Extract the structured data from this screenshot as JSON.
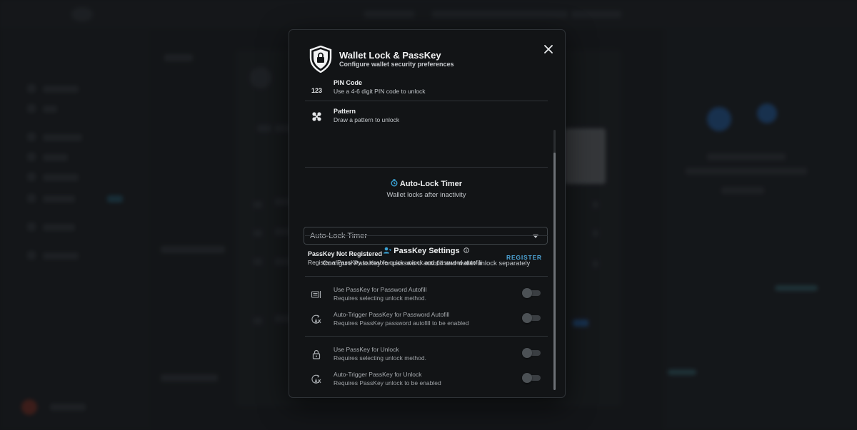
{
  "modal": {
    "title": "Wallet Lock & PassKey",
    "subtitle": "Configure wallet security preferences"
  },
  "unlock_methods": [
    {
      "label": "PIN Code",
      "description": "Use a 4-6 digit PIN code to unlock",
      "icon": "123-icon",
      "icon_text": "123"
    },
    {
      "label": "Pattern",
      "description": "Draw a pattern to unlock",
      "icon": "pattern-icon"
    }
  ],
  "auto_lock": {
    "title": "Auto-Lock Timer",
    "subtitle": "Wallet locks after inactivity",
    "select_placeholder": "Auto-Lock Timer",
    "icon": "timer-icon"
  },
  "passkey": {
    "title": "PassKey Settings",
    "subtitle": "Configure PassKey for password autofill and wallet unlock separately",
    "status_title": "PassKey Not Registered",
    "status_description": "Register a PassKey to enable quick unlock and password autofill",
    "register_label": "REGISTER",
    "icon": "user-key-icon",
    "info_icon": "info-icon",
    "accent_color": "#4ea6d9"
  },
  "toggles": [
    {
      "label": "Use PassKey for Password Autofill",
      "description": "Requires selecting unlock method.",
      "icon": "keyboard-icon",
      "enabled": false
    },
    {
      "label": "Auto-Trigger PassKey for Password Autofill",
      "description": "Requires PassKey password autofill to be enabled",
      "icon": "auto-trigger-icon",
      "enabled": false
    },
    {
      "label": "Use PassKey for Unlock",
      "description": "Requires selecting unlock method.",
      "icon": "lock-icon",
      "enabled": false
    },
    {
      "label": "Auto-Trigger PassKey for Unlock",
      "description": "Requires PassKey unlock to be enabled",
      "icon": "auto-trigger-icon",
      "enabled": false
    }
  ]
}
